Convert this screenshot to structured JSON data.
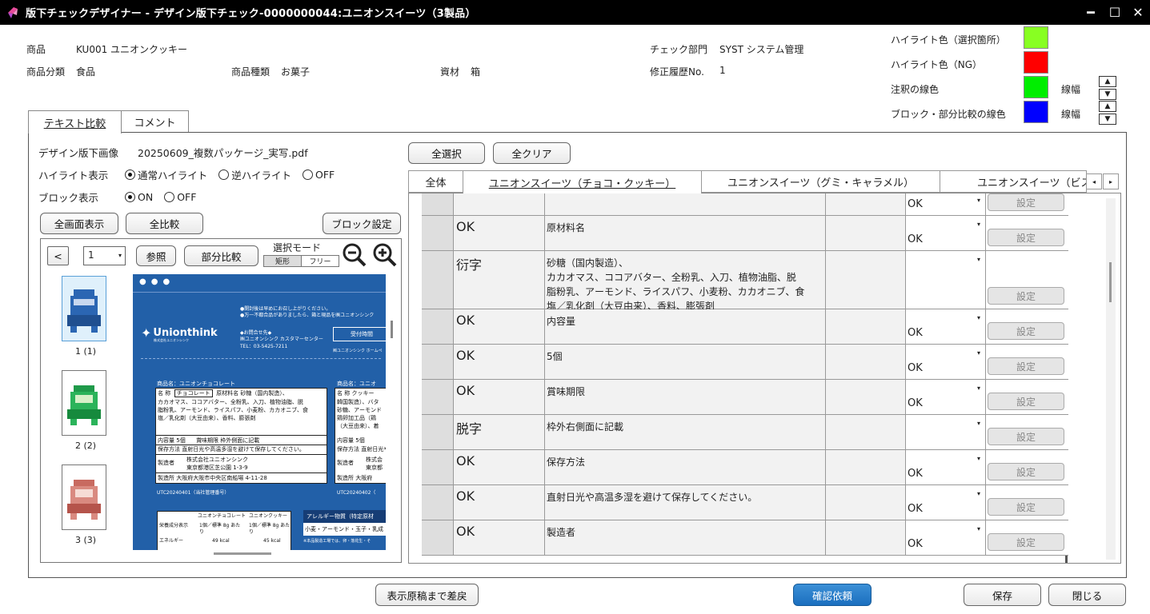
{
  "window": {
    "title": "版下チェックデザイナー - デザイン版下チェック-0000000044:ユニオンスイーツ（3製品）"
  },
  "header": {
    "product_label": "商品",
    "product_value": "KU001 ユニオンクッキー",
    "category_label": "商品分類",
    "category_value": "食品",
    "type_label": "商品種類",
    "type_value": "お菓子",
    "material_label": "資材",
    "material_value": "箱",
    "dept_label": "チェック部門",
    "dept_value": "SYST システム管理",
    "revision_label": "修正履歴No.",
    "revision_value": "1",
    "colors": [
      {
        "label": "ハイライト色（選択箇所）",
        "color": "#88ff22"
      },
      {
        "label": "ハイライト色（NG）",
        "color": "#ff0000"
      },
      {
        "label": "注釈の線色",
        "color": "#00ee00",
        "width_label": "線幅"
      },
      {
        "label": "ブロック・部分比較の線色",
        "color": "#0000ff",
        "width_label": "線幅"
      }
    ]
  },
  "tabs": [
    "テキスト比較",
    "コメント"
  ],
  "left": {
    "image_label": "デザイン版下画像",
    "image_file": "20250609_複数パッケージ_実写.pdf",
    "highlight_label": "ハイライト表示",
    "highlight_options": [
      "通常ハイライト",
      "逆ハイライト",
      "OFF"
    ],
    "block_label": "ブロック表示",
    "block_options": [
      "ON",
      "OFF"
    ],
    "btn_fullscreen": "全画面表示",
    "btn_compare_all": "全比較",
    "btn_block_settings": "ブロック設定",
    "btn_prev": "<",
    "page_value": "1",
    "btn_browse": "参照",
    "btn_partial": "部分比較",
    "select_mode_label": "選択モード",
    "mode_rect": "矩形",
    "mode_free": "フリー",
    "thumbs": [
      "1 (1)",
      "2 (2)",
      "3 (3)"
    ],
    "pkg": {
      "brand": "Unionthink",
      "brand_sub": "株式会社ユニオンシンク",
      "notice1": "●開封後は早めにお召し上がりください。",
      "notice2": "●万一不都合品がありましたら、箱と現品を㈱ユニオンシンク",
      "contact1": "◆お問合せ先◆",
      "contact2": "㈱ユニオンシンク カスタマーセンター",
      "tel": "TEL：03-5425-7211",
      "reception": "受付時間",
      "homepage": "㈱ユニオンシンク ホームペ",
      "name1": "商品名：ユニオンチョコレート",
      "name2": "商品名：ユニオ",
      "t_name": "名 称",
      "t_choco": "チョコレート",
      "t_material": "原材料名",
      "t_sugar": "砂糖（国内製造）、",
      "t_line2": "カカオマス、ココアバター、全粉乳、入刀、植物油脂、脱",
      "t_line3": "脂粉乳、アーモンド、ライスパフ、小麦粉、カカオニブ、食",
      "t_line4": "塩／乳化剤（大豆由来）、香料、膨張剤",
      "t_qty": "内容量",
      "t_qty_val": "5個",
      "t_exp": "賞味期限",
      "t_exp_val": "枠外側面に記載",
      "t_store": "保存方法",
      "t_store_val": "直射日光や高温多湿を避けて保存してください。",
      "t_maker": "製造者",
      "t_maker_val1": "株式会社ユニオンシンク",
      "t_maker_val2": "東京都港区芝公園 1-3-9",
      "t_plant": "製造所",
      "t_plant_val": "大阪府大阪市中央区南船場 4-11-28",
      "code1": "UTC20240401（当社管理番号）",
      "code2": "UTC20240402（",
      "r_cookie": "クッキー",
      "r_kr": "韓国製造）、バタ",
      "r_sugar": "砂糖、アーモンド",
      "r_egg": "鶏卵加工品（鶏",
      "r_soy": "（大豆由来）、着",
      "r_qty_val": "5個",
      "r_store": "直射日光や",
      "r_maker1": "株式会",
      "r_maker2": "東京都",
      "r_plant": "大阪府",
      "nut_h1": "ユニオンチョコレート",
      "nut_h2": "ユニオンクッキー",
      "nut_label": "栄養成分表示",
      "nut_serv": "1個／標準 8g あたり",
      "nut_energy": "エネルギー",
      "nut_v1": "49 kcal",
      "nut_v2": "45 kcal",
      "allergy": "アレルギー物質（特定原材",
      "allergy_list": "小麦・アーモンド・玉子・乳成",
      "allergy_note": "※本品製造工場では、卵・落花生・そ"
    }
  },
  "right": {
    "btn_select_all": "全選択",
    "btn_clear_all": "全クリア",
    "tabs": [
      "全体",
      "ユニオンスイーツ（チョコ・クッキー）",
      "ユニオンスイーツ（グミ・キャラメル）",
      "ユニオンスイーツ（ビスケ"
    ],
    "rows": [
      {
        "status": "",
        "text": "",
        "value": "OK",
        "set": "設定"
      },
      {
        "status": "OK",
        "text": "原材料名",
        "value": "OK",
        "set": "設定"
      },
      {
        "status": "衍字",
        "text": "砂糖（国内製造）、\nカカオマス、ココアバター、全粉乳、入刀、植物油脂、脱\n脂粉乳、アーモンド、ライスパフ、小麦粉、カカオニブ、食\n塩／乳化剤（大豆由来）、香料、膨張剤",
        "value": "",
        "set": "設定"
      },
      {
        "status": "OK",
        "text": "内容量",
        "value": "OK",
        "set": "設定"
      },
      {
        "status": "OK",
        "text": "5個",
        "value": "OK",
        "set": "設定"
      },
      {
        "status": "OK",
        "text": "賞味期限",
        "value": "OK",
        "set": "設定"
      },
      {
        "status": "脱字",
        "text": "枠外右側面に記載",
        "value": "",
        "set": "設定"
      },
      {
        "status": "OK",
        "text": "保存方法",
        "value": "OK",
        "set": "設定"
      },
      {
        "status": "OK",
        "text": "直射日光や高温多湿を避けて保存してください。",
        "value": "OK",
        "set": "設定"
      },
      {
        "status": "OK",
        "text": "製造者",
        "value": "OK",
        "set": "設定"
      }
    ]
  },
  "footer": {
    "btn_diff": "表示原稿まで差戻",
    "btn_confirm": "確認依頼",
    "btn_save": "保存",
    "btn_close": "閉じる"
  }
}
